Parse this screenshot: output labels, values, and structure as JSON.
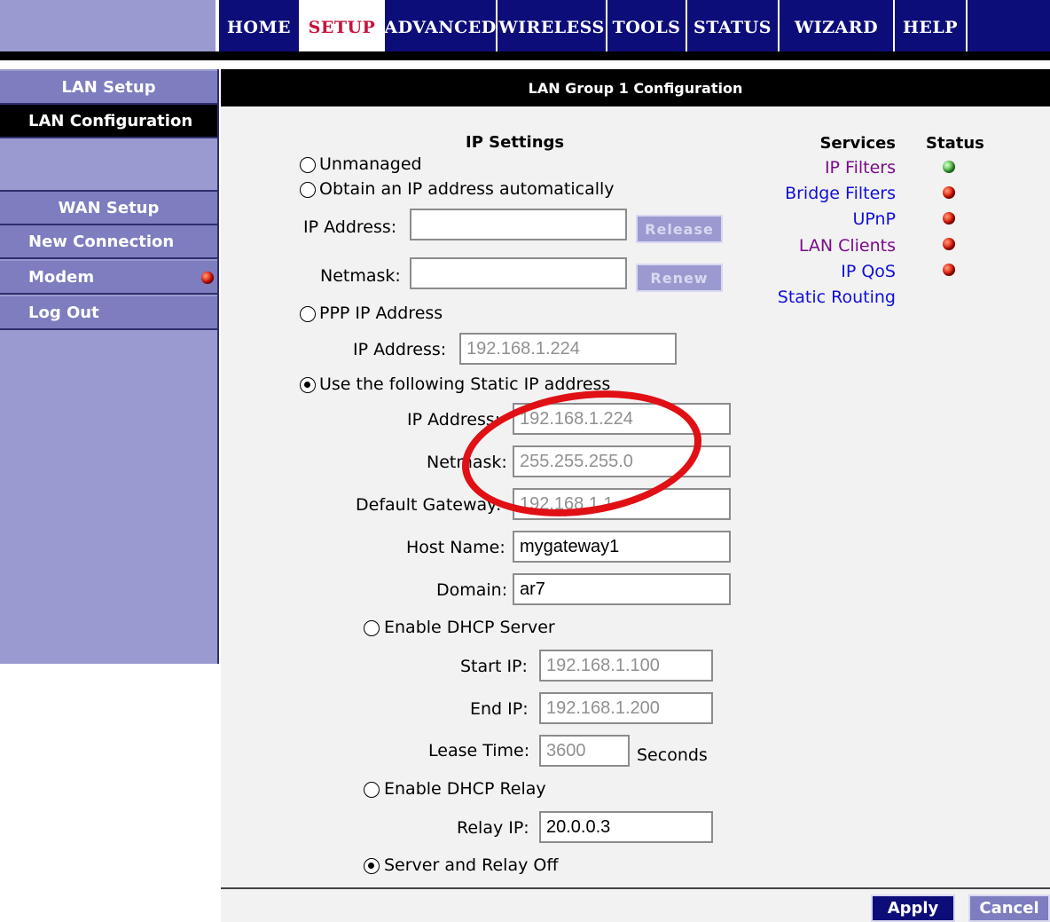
{
  "nav": {
    "tabs": [
      {
        "label": "HOME"
      },
      {
        "label": "SETUP"
      },
      {
        "label": "ADVANCED"
      },
      {
        "label": "WIRELESS"
      },
      {
        "label": "TOOLS"
      },
      {
        "label": "STATUS"
      },
      {
        "label": "WIZARD"
      },
      {
        "label": "HELP"
      }
    ],
    "active": "SETUP"
  },
  "sidebar": {
    "lan_header": "LAN Setup",
    "lan_configuration": "LAN Configuration",
    "wan_header": "WAN Setup",
    "new_connection": "New Connection",
    "modem": "Modem",
    "log_out": "Log Out"
  },
  "main": {
    "title": "LAN Group 1 Configuration",
    "ip_settings_title": "IP Settings",
    "unmanaged": "Unmanaged",
    "obtain_auto": "Obtain an IP address automatically",
    "auto_ip_label": "IP Address:",
    "auto_netmask_label": "Netmask:",
    "release_button": "Release",
    "renew_button": "Renew",
    "ppp_ip": "PPP IP Address",
    "ppp_ip_label": "IP Address:",
    "ppp_ip_value": "192.168.1.224",
    "static_ip": "Use the following Static IP address",
    "static_ip_label": "IP Address:",
    "static_ip_value": "192.168.1.224",
    "static_netmask_label": "Netmask:",
    "static_netmask_value": "255.255.255.0",
    "gateway_label": "Default Gateway:",
    "gateway_value": "192.168.1.1",
    "host_label": "Host Name:",
    "host_value": "mygateway1",
    "domain_label": "Domain:",
    "domain_value": "ar7",
    "dhcp_server": "Enable DHCP Server",
    "start_ip_label": "Start IP:",
    "start_ip_value": "192.168.1.100",
    "end_ip_label": "End IP:",
    "end_ip_value": "192.168.1.200",
    "lease_label": "Lease Time:",
    "lease_value": "3600",
    "lease_unit": "Seconds",
    "dhcp_relay": "Enable DHCP Relay",
    "relay_ip_label": "Relay IP:",
    "relay_ip_value": "20.0.0.3",
    "relay_off": "Server and Relay Off",
    "selected_mode": "static",
    "selected_dhcp": "off"
  },
  "services": {
    "header": "Services",
    "status_header": "Status",
    "items": [
      {
        "label": "IP Filters",
        "status": "green"
      },
      {
        "label": "Bridge Filters",
        "status": "red"
      },
      {
        "label": "UPnP",
        "status": "red"
      },
      {
        "label": "LAN Clients",
        "status": "red"
      },
      {
        "label": "IP QoS",
        "status": "red"
      },
      {
        "label": "Static Routing",
        "status": ""
      }
    ]
  },
  "footer": {
    "apply": "Apply",
    "cancel": "Cancel"
  },
  "colors": {
    "nav_bg": "#0d0d7a",
    "active_tab_text": "#c8123c",
    "sidebar_bg": "#9a9ad0",
    "link_purple": "#7a0a8a",
    "link_blue": "#1010d8",
    "annotation_circle": "#e01015"
  }
}
